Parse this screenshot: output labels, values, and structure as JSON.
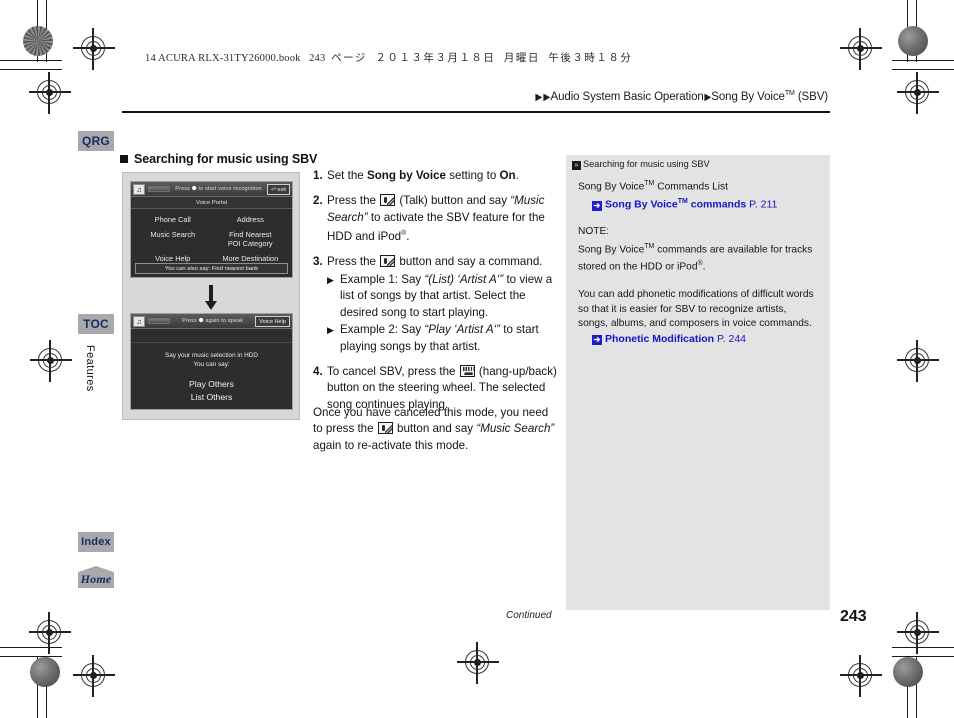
{
  "print_header": {
    "bookline_en": "14 ACURA RLX-31TY26000.book",
    "bookline_page": "243",
    "bookline_jp_page_unit": "ページ",
    "bookline_date": "２０１３年３月１８日",
    "bookline_day": "月曜日",
    "bookline_time": "午後３時１８分"
  },
  "breadcrumb": {
    "arrow": "▶",
    "part1": "Audio System Basic Operation",
    "sep": "▶",
    "part2": "Song By Voice",
    "tm": "TM",
    "part3": " (SBV)"
  },
  "sidetabs": {
    "qrg": "QRG",
    "toc": "TOC",
    "features": "Features",
    "index": "Index",
    "home": "Home"
  },
  "section": {
    "heading": "Searching for music using SBV"
  },
  "illustration": {
    "screen1": {
      "mic_icon": "mic-icon",
      "bar_text_pre": "Press ",
      "bar_text_btn": "⚉",
      "bar_text_post": " to start voice recognition",
      "bar_button": "exit",
      "title": "Voice Portal",
      "menu": [
        "Phone Call",
        "Address",
        "Music Search",
        "Find Nearest\nPOI Category",
        "Voice Help",
        "More Destination\nMethods"
      ],
      "footer": "You can also say: Find nearest bank"
    },
    "screen2": {
      "mic_icon": "mic-icon",
      "bar_text_pre": "Press ",
      "bar_text_btn": "⚉",
      "bar_text_post": " again to speak",
      "bar_button": "Voice Help",
      "line1": "Say your music selection in HDD",
      "line2": "You can say:",
      "option1": "Play Others",
      "option2": "List Others"
    }
  },
  "steps": [
    {
      "num": "1.",
      "parts": [
        {
          "t": "Set the ",
          "s": "plain"
        },
        {
          "t": "Song by Voice",
          "s": "bold"
        },
        {
          "t": " setting to ",
          "s": "plain"
        },
        {
          "t": "On",
          "s": "bold"
        },
        {
          "t": ".",
          "s": "plain"
        }
      ]
    },
    {
      "num": "2.",
      "parts": [
        {
          "t": "Press the ",
          "s": "plain"
        },
        {
          "t": "",
          "s": "glyph-talk"
        },
        {
          "t": " (Talk) button and say ",
          "s": "plain"
        },
        {
          "t": "“Music Search”",
          "s": "italic"
        },
        {
          "t": " to activate the SBV feature for the HDD and iPod",
          "s": "plain"
        },
        {
          "t": "®",
          "s": "sup"
        },
        {
          "t": ".",
          "s": "plain"
        }
      ]
    },
    {
      "num": "3.",
      "parts": [
        {
          "t": "Press the ",
          "s": "plain"
        },
        {
          "t": "",
          "s": "glyph-talk"
        },
        {
          "t": " button and say a command.",
          "s": "plain"
        }
      ],
      "subs": [
        {
          "bullet": "▶",
          "parts": [
            {
              "t": "Example 1: Say ",
              "s": "plain"
            },
            {
              "t": "“(List) ‘Artist A‘”",
              "s": "italic"
            },
            {
              "t": " to view a list of songs by that artist. Select the desired song to start playing.",
              "s": "plain"
            }
          ]
        },
        {
          "bullet": "▶",
          "parts": [
            {
              "t": "Example 2: Say ",
              "s": "plain"
            },
            {
              "t": "“Play ‘Artist A‘”",
              "s": "italic"
            },
            {
              "t": " to start playing songs by that artist.",
              "s": "plain"
            }
          ]
        }
      ]
    },
    {
      "num": "4.",
      "parts": [
        {
          "t": "To cancel SBV, press the ",
          "s": "plain"
        },
        {
          "t": "",
          "s": "glyph-hangup"
        },
        {
          "t": " (hang-up/back) button on the steering wheel. The selected song continues playing.",
          "s": "plain"
        }
      ]
    }
  ],
  "closing_paragraph": {
    "parts": [
      {
        "t": "Once you have canceled this mode, you need to press the ",
        "s": "plain"
      },
      {
        "t": "",
        "s": "glyph-talk"
      },
      {
        "t": " button and say ",
        "s": "plain"
      },
      {
        "t": "“Music Search”",
        "s": "italic"
      },
      {
        "t": " again to re-activate this mode.",
        "s": "plain"
      }
    ]
  },
  "sidepanel": {
    "header": "Searching for music using SBV",
    "line1": "Song By Voice",
    "line1_tm": "TM",
    "line1_rest": " Commands List",
    "link1_label": "Song By Voice",
    "link1_tm": "TM",
    "link1_rest": " commands",
    "link1_page": "P. 211",
    "note_label": "NOTE:",
    "note_text_a": "Song By Voice",
    "note_tm": "TM",
    "note_text_b": " commands are available for tracks stored on the HDD or iPod",
    "note_reg": "®",
    "note_text_c": ".",
    "para2": "You can add phonetic modifications of difficult words so that it is easier for SBV to recognize artists, songs, albums, and composers in voice commands.",
    "link2_label": "Phonetic Modification",
    "link2_page": "P. 244",
    "arrow_glyph": "➔"
  },
  "footer": {
    "continued": "Continued",
    "page_number": "243"
  },
  "colors": {
    "tab_bg": "#a7a9ac",
    "tab_text": "#1b2a5e",
    "link_blue": "#1414c8",
    "panel_bg": "#e3e3e3",
    "screen_bg": "#2d2d2d"
  }
}
